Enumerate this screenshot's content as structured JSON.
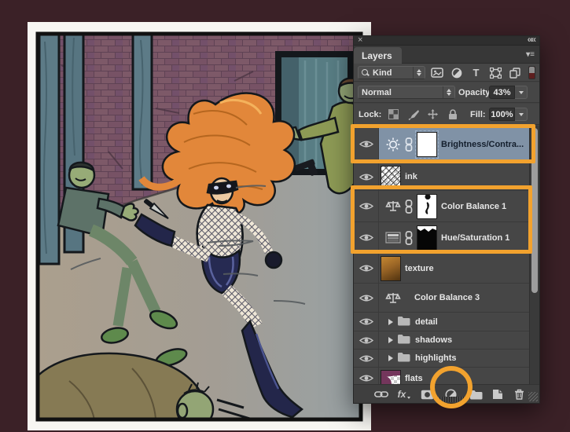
{
  "window": {
    "close_glyph": "×",
    "collapse_glyph": "««",
    "panel_menu_glyph": "▾≡"
  },
  "panel": {
    "tab_label": "Layers",
    "filter": {
      "kind_label": "Kind",
      "type_filter_glyph": "T"
    },
    "blend_mode": "Normal",
    "opacity_label": "Opacity:",
    "opacity_value": "43%",
    "lock_label": "Lock:",
    "fill_label": "Fill:",
    "fill_value": "100%",
    "layers": [
      {
        "name": "Brightness/Contra...",
        "kind": "adjustment-brightness-contrast",
        "selected": true
      },
      {
        "name": "ink",
        "kind": "pixel-layer"
      },
      {
        "name": "Color Balance 1",
        "kind": "adjustment-color-balance"
      },
      {
        "name": "Hue/Saturation 1",
        "kind": "adjustment-hue-saturation"
      },
      {
        "name": "texture",
        "kind": "pixel-layer"
      },
      {
        "name": "Color Balance 3",
        "kind": "adjustment-color-balance"
      },
      {
        "name": "detail",
        "kind": "group"
      },
      {
        "name": "shadows",
        "kind": "group"
      },
      {
        "name": "highlights",
        "kind": "group"
      },
      {
        "name": "flats",
        "kind": "pixel-layer"
      }
    ],
    "toolbar": {
      "fx_label": "fx",
      "icons": [
        "link-layers",
        "layer-effects",
        "add-layer-mask",
        "new-adjustment-layer",
        "new-group",
        "new-layer",
        "delete-layer"
      ]
    }
  },
  "annotations": {
    "accent_color": "#f2a22e",
    "highlighted_rows": [
      "Brightness/Contra...",
      "Color Balance 1",
      "Hue/Saturation 1"
    ],
    "circled_tool": "new-adjustment-layer"
  },
  "artwork_palette": {
    "page_background": "#3b2127",
    "brick": "#7d5968",
    "mortar": "#5f4254",
    "post": "#5d7b87",
    "floor_left": "#ab9f8d",
    "floor_right": "#98a1a4",
    "hair": "#e2873a",
    "skin": "#eccaa2",
    "costume_navy": "#23264a",
    "fishnet": "#eee6d6",
    "villain_skin": "#97ab77",
    "villain_suit": "#5d7268",
    "coat_olive": "#8d9a55",
    "fallen_jacket": "#867a54",
    "door_teal": "#587d84"
  }
}
